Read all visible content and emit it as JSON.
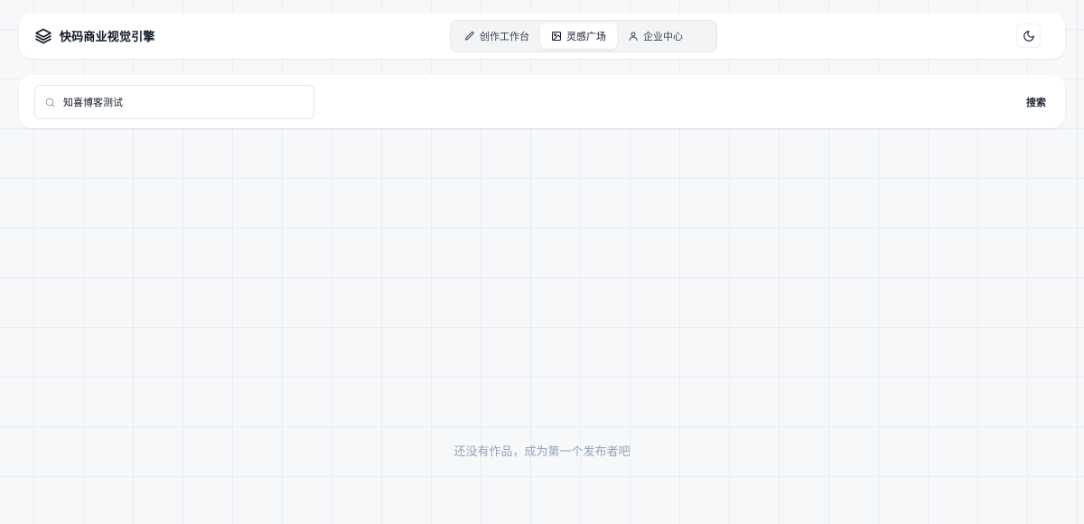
{
  "app": {
    "brand_icon": "layers-icon",
    "name": "快码商业视觉引擎"
  },
  "nav": {
    "tabs": [
      {
        "label": "创作工作台",
        "icon": "pen-icon",
        "active": false
      },
      {
        "label": "灵感广场",
        "icon": "image-icon",
        "active": true
      },
      {
        "label": "企业中心",
        "icon": "user-icon",
        "active": false
      }
    ],
    "theme_toggle_icon": "moon-icon"
  },
  "search": {
    "icon": "search-icon",
    "value": "知喜博客测试",
    "button_label": "搜索"
  },
  "gallery": {
    "empty_message": "还没有作品，成为第一个发布者吧"
  },
  "colors": {
    "background": "#f7f8fa",
    "grid_line": "#eaedf1",
    "panel": "#ffffff",
    "text_primary": "#111827",
    "text_muted": "#94a3b8"
  }
}
